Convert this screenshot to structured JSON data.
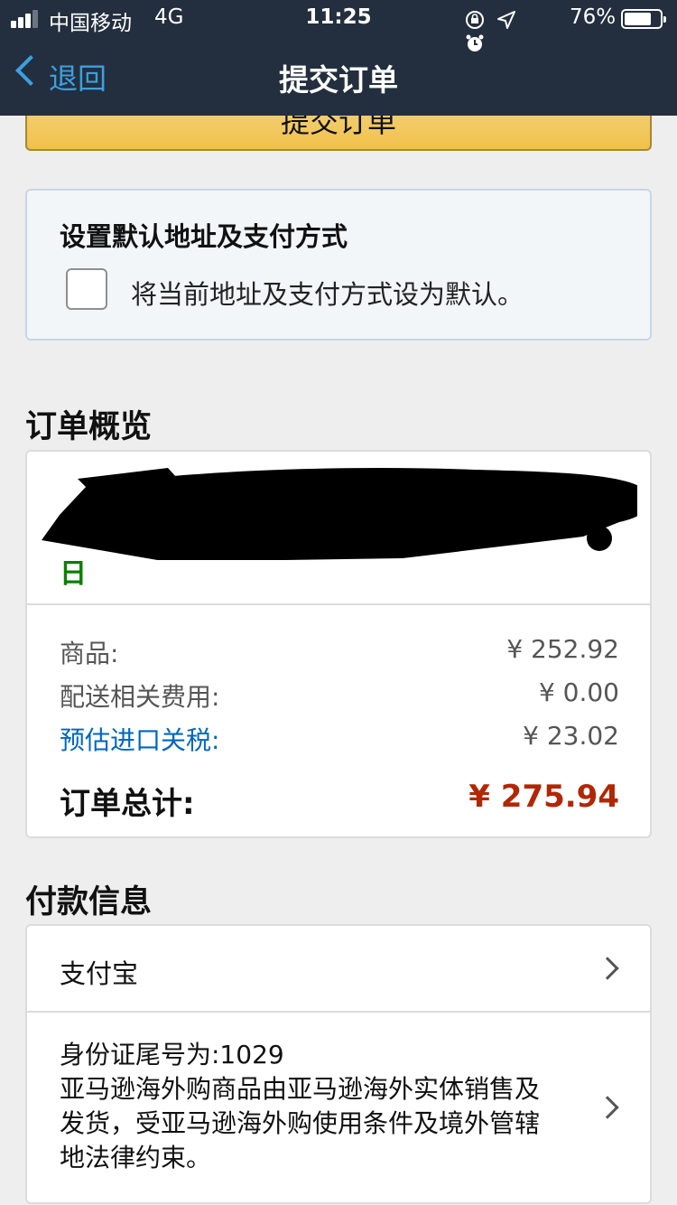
{
  "status_bar": {
    "carrier": "中国移动",
    "network": "4G",
    "time": "11:25",
    "battery": "76%",
    "battery_level": 0.76
  },
  "nav": {
    "back_label": "退回",
    "title": "提交订单"
  },
  "submit_button": {
    "label": "提交订单"
  },
  "default_setting": {
    "title": "设置默认地址及支付方式",
    "checkbox_label": "将当前地址及支付方式设为默认。",
    "checked": false
  },
  "order_summary": {
    "title": "订单概览",
    "delivery_date_tail": "日",
    "rows": [
      {
        "label": "商品:",
        "value": "¥ 252.92"
      },
      {
        "label": "配送相关费用:",
        "value": "¥ 0.00"
      },
      {
        "label": "预估进口关税:",
        "value": "¥ 23.02"
      }
    ],
    "total_label": "订单总计:",
    "total_value": "¥ 275.94"
  },
  "payment": {
    "title": "付款信息",
    "method": "支付宝",
    "id_line": "身份证尾号为:1029",
    "terms_line1": "亚马逊海外购商品由亚马逊海外实体销售及",
    "terms_line2": "发货，受亚马逊海外购使用条件及境外管辖",
    "terms_line3": "地法律约束。"
  },
  "colors": {
    "header_bg": "#232f3e",
    "link_blue": "#0066c0",
    "back_blue": "#3d9fe0",
    "total_red": "#b12704",
    "delivery_green": "#0a8000",
    "button_yellow": "#f0c14b"
  }
}
